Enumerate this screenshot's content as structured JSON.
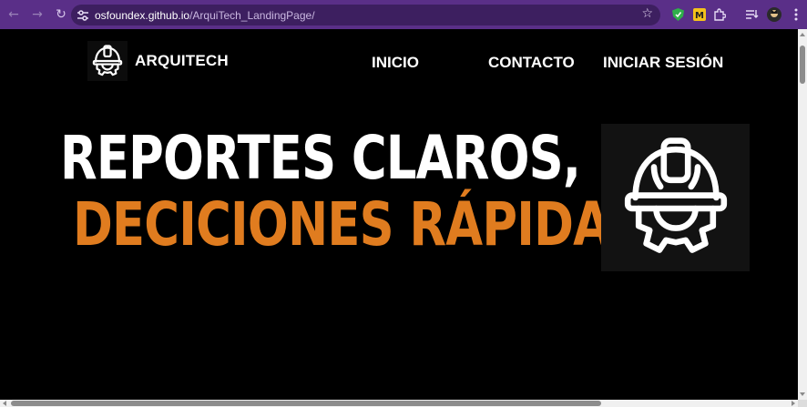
{
  "browser": {
    "url_host": "osfoundex.github.io",
    "url_path": "/ArquiTech_LandingPage/",
    "icons": [
      "back-icon",
      "forward-icon",
      "reload-icon",
      "site-info-icon",
      "bookmark-star-icon",
      "shield-extension-icon",
      "m-extension-icon",
      "extensions-puzzle-icon",
      "reading-list-icon",
      "profile-avatar-icon",
      "kebab-menu-icon"
    ]
  },
  "header": {
    "brand_name": "ARQUITECH",
    "nav": [
      {
        "label": "INICIO"
      },
      {
        "label": "CONTACTO"
      },
      {
        "label": "INICIAR SESIÓN"
      }
    ]
  },
  "hero": {
    "line1": "REPORTES CLAROS,",
    "line2": "DECICIONES RÁPIDAS"
  },
  "colors": {
    "chrome_bg": "#5a2f88",
    "page_bg": "#000000",
    "accent_orange": "#e07c1f",
    "text_white": "#ffffff"
  }
}
